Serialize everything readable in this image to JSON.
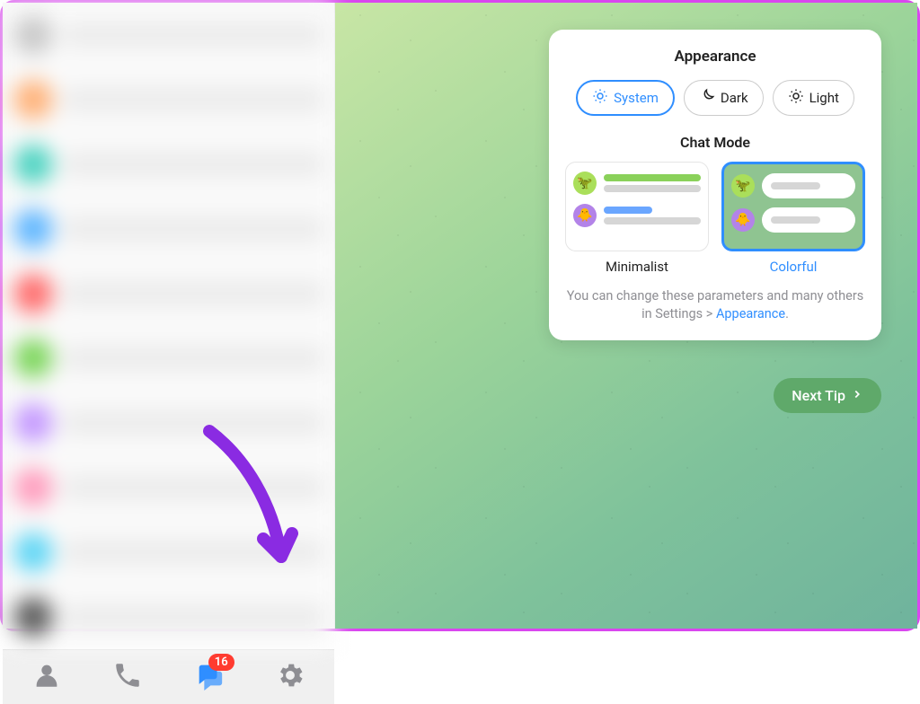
{
  "card": {
    "title": "Appearance",
    "theme_options": {
      "system": "System",
      "dark": "Dark",
      "light": "Light"
    },
    "chat_mode_title": "Chat Mode",
    "mode_options": {
      "minimalist": "Minimalist",
      "colorful": "Colorful"
    },
    "footer_prefix": "You can change these parameters and many others in Settings > ",
    "footer_link": "Appearance",
    "footer_suffix": "."
  },
  "next_tip_label": "Next Tip",
  "bottom_bar": {
    "badge_count": "16"
  }
}
